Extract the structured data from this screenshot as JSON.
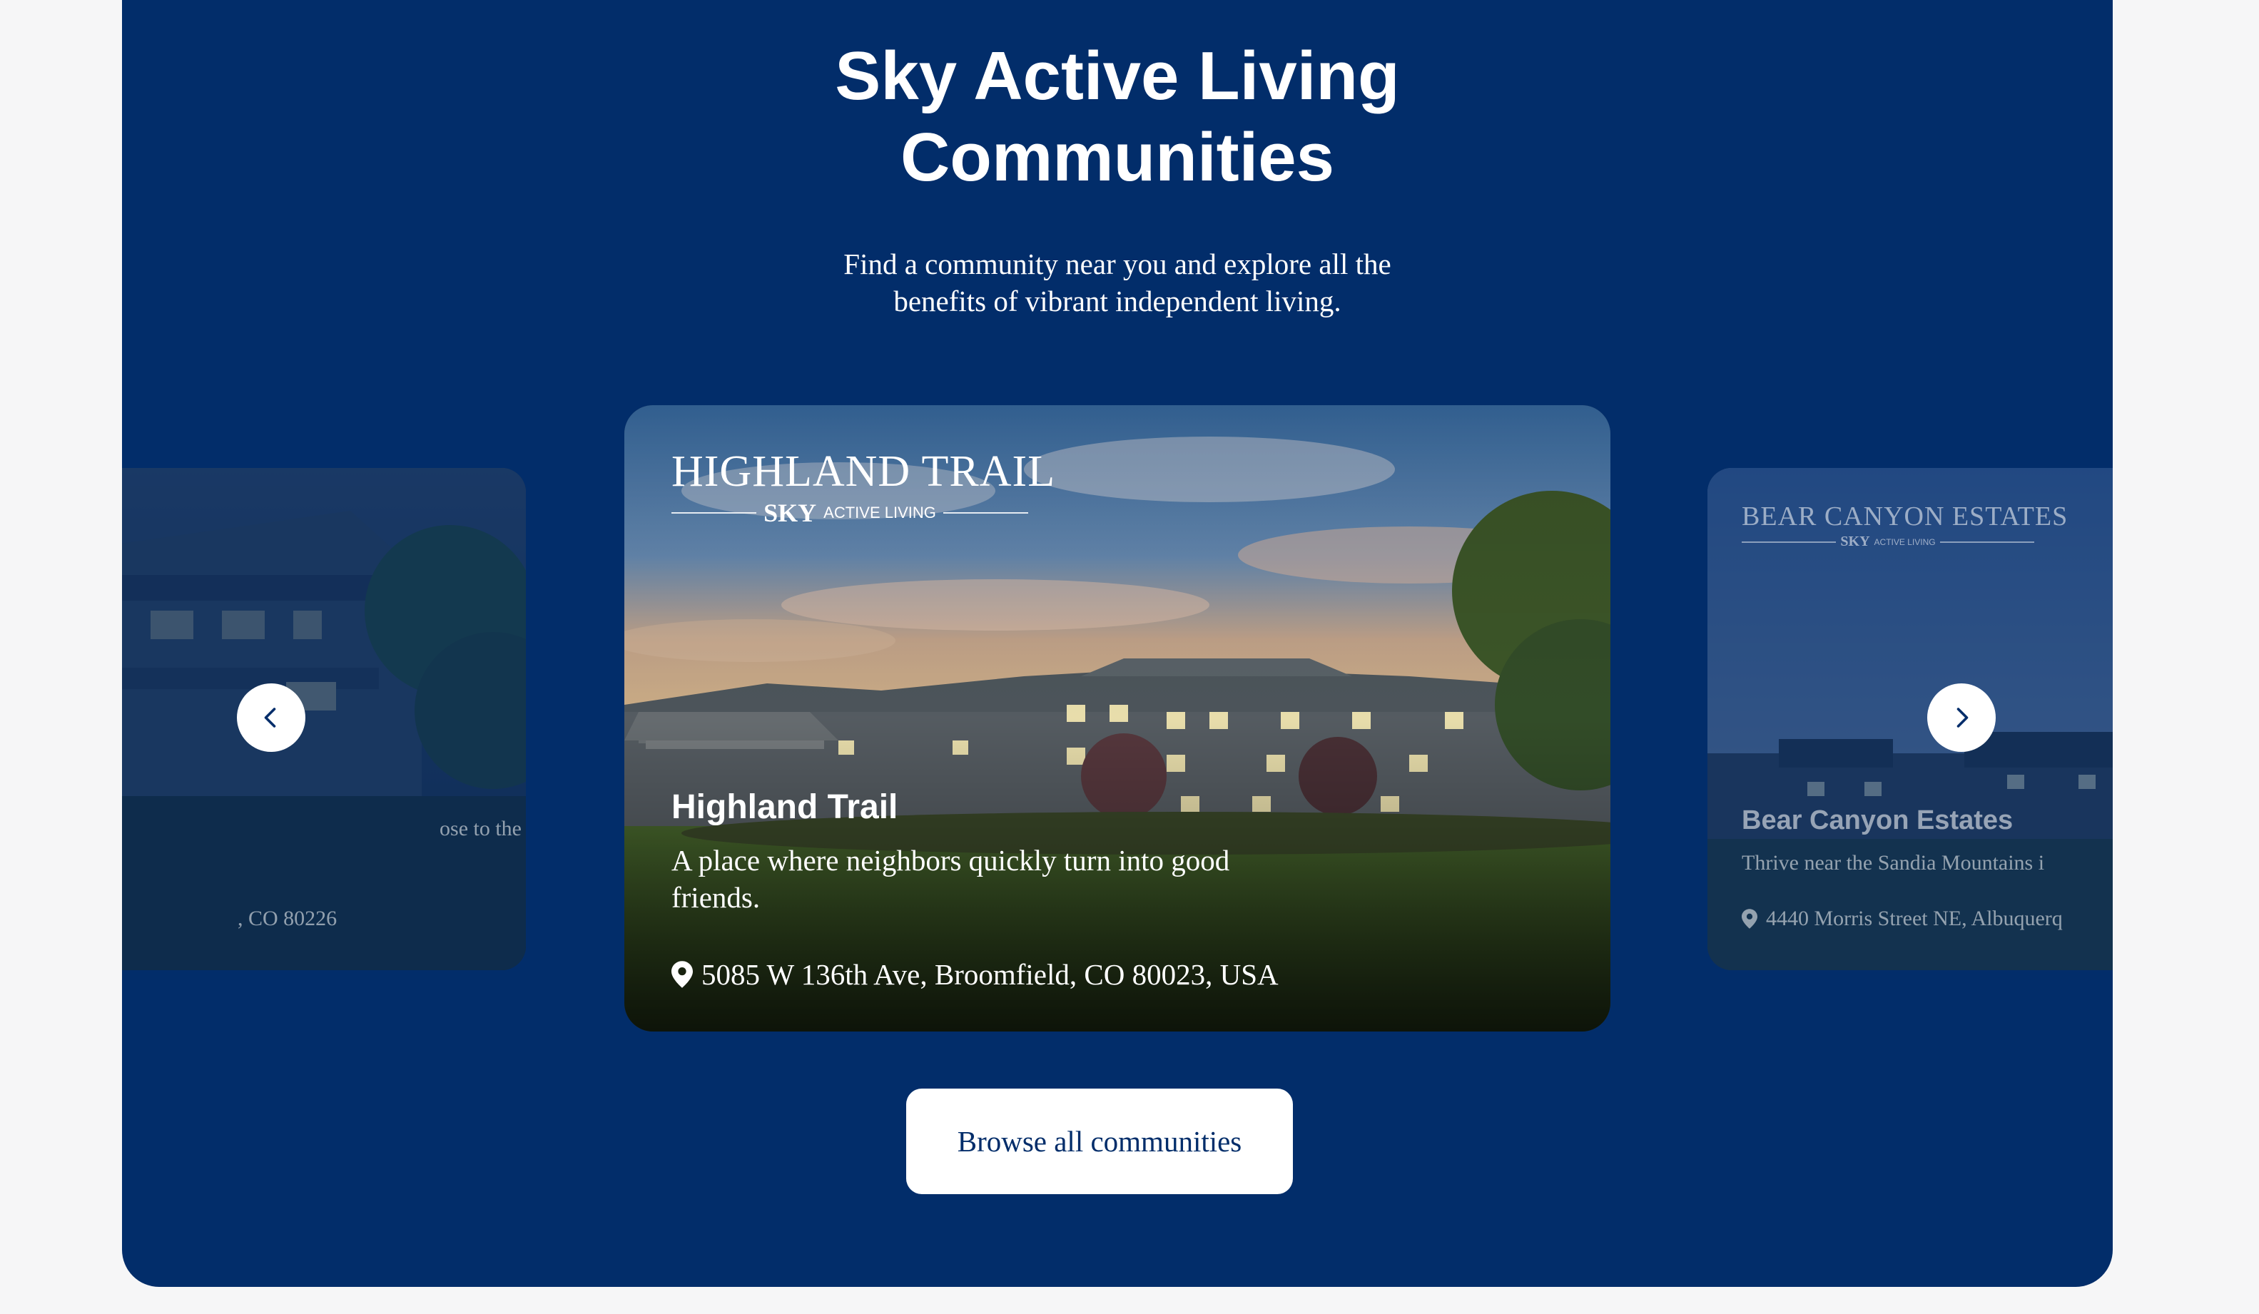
{
  "section": {
    "heading_line1": "Sky Active Living",
    "heading_line2": "Communities",
    "subtitle_line1": "Find a community near you and explore all the",
    "subtitle_line2": "benefits of vibrant independent living."
  },
  "carousel": {
    "prev_icon": "chevron-left-icon",
    "next_icon": "chevron-right-icon",
    "left_card": {
      "desc_fragment": "ose to the",
      "address_fragment": ", CO 80226"
    },
    "active_card": {
      "logo_title": "HIGHLAND TRAIL",
      "logo_brand": "SKY",
      "logo_tagline": "ACTIVE LIVING",
      "name": "Highland Trail",
      "description": "A place where neighbors quickly turn into good friends.",
      "address": "5085 W 136th Ave, Broomfield, CO 80023, USA"
    },
    "right_card": {
      "logo_title": "BEAR CANYON ESTATES",
      "logo_brand": "SKY",
      "logo_tagline": "ACTIVE LIVING",
      "name": "Bear Canyon Estates",
      "description": "Thrive near the Sandia Mountains i",
      "address": "4440 Morris Street NE, Albuquerq"
    }
  },
  "cta": {
    "label": "Browse all communities"
  },
  "colors": {
    "panel": "#022d6a",
    "page_bg": "#f6f6f7",
    "button_text": "#022d6a"
  }
}
